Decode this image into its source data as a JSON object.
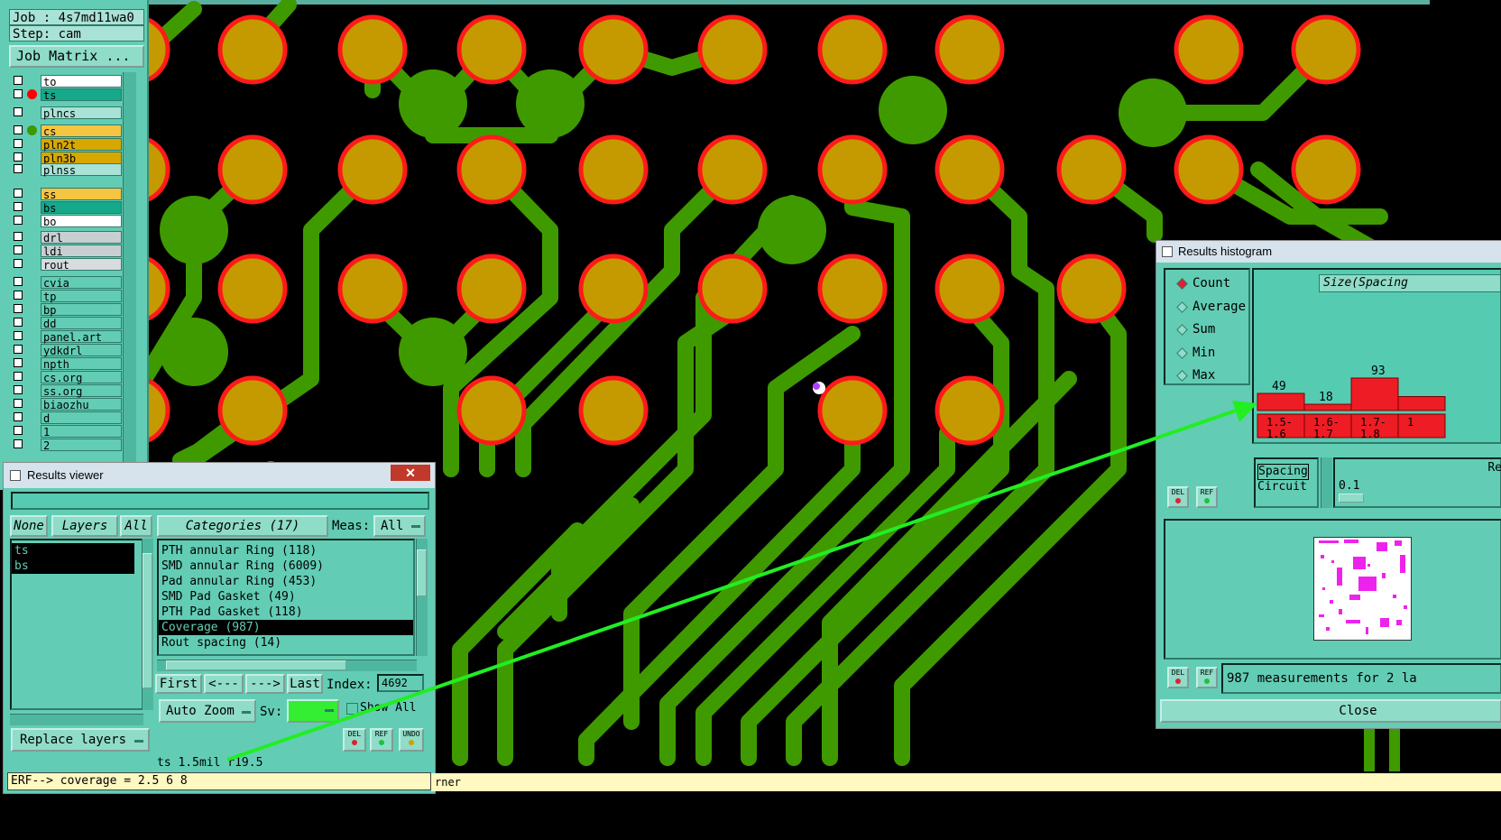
{
  "job_panel": {
    "job": "Job : 4s7md11wa0",
    "step": "Step: cam",
    "job_matrix": "Job Matrix ...",
    "layers": [
      {
        "name": "to",
        "bg": "#ffffff",
        "dot": ""
      },
      {
        "name": "ts",
        "bg": "#15a88a",
        "dot": "#ff0000"
      },
      {
        "name": "plncs",
        "bg": "#a9e2d6",
        "dot": ""
      },
      {
        "name": "cs",
        "bg": "#f5c542",
        "dot": "#3a9a00"
      },
      {
        "name": "pln2t",
        "bg": "#d8a800",
        "dot": ""
      },
      {
        "name": "pln3b",
        "bg": "#d8a800",
        "dot": ""
      },
      {
        "name": "plnss",
        "bg": "#a9e2d6",
        "dot": ""
      },
      {
        "name": "ss",
        "bg": "#f5c542",
        "dot": ""
      },
      {
        "name": "bs",
        "bg": "#15a88a",
        "dot": ""
      },
      {
        "name": "bo",
        "bg": "#ffffff",
        "dot": ""
      },
      {
        "name": "drl",
        "bg": "#c8cfd3",
        "dot": ""
      },
      {
        "name": "ldi",
        "bg": "#c8cfd3",
        "dot": ""
      },
      {
        "name": "rout",
        "bg": "#d8dcdf",
        "dot": ""
      },
      {
        "name": "cvia",
        "bg": "#62cdb4",
        "dot": ""
      },
      {
        "name": "tp",
        "bg": "#62cdb4",
        "dot": ""
      },
      {
        "name": "bp",
        "bg": "#62cdb4",
        "dot": ""
      },
      {
        "name": "dd",
        "bg": "#62cdb4",
        "dot": ""
      },
      {
        "name": "panel.art",
        "bg": "#62cdb4",
        "dot": ""
      },
      {
        "name": "ydkdrl",
        "bg": "#62cdb4",
        "dot": ""
      },
      {
        "name": "npth",
        "bg": "#62cdb4",
        "dot": ""
      },
      {
        "name": "cs.org",
        "bg": "#62cdb4",
        "dot": ""
      },
      {
        "name": "ss.org",
        "bg": "#62cdb4",
        "dot": ""
      },
      {
        "name": "biaozhu",
        "bg": "#62cdb4",
        "dot": ""
      },
      {
        "name": "d",
        "bg": "#62cdb4",
        "dot": ""
      },
      {
        "name": "1",
        "bg": "#62cdb4",
        "dot": ""
      },
      {
        "name": "2",
        "bg": "#62cdb4",
        "dot": ""
      }
    ]
  },
  "results_viewer": {
    "title": "Results viewer",
    "close": "✕",
    "none_btn": "None",
    "layers_btn": "Layers",
    "all_btn": "All",
    "layer_list": [
      "ts",
      "bs"
    ],
    "categories_btn": "Categories (17)",
    "meas_label": "Meas:",
    "meas_value": "All",
    "categories": [
      "PTH annular Ring (118)",
      "SMD annular Ring (6009)",
      "Pad annular Ring (453)",
      "SMD Pad Gasket (49)",
      "PTH Pad Gasket (118)",
      "Coverage (987)",
      "Rout spacing (14)"
    ],
    "selected_category": 5,
    "first": "First",
    "prev": "<---",
    "next": "--->",
    "last": "Last",
    "index_label": "Index:",
    "index_value": "4692",
    "auto_zoom": "Auto Zoom",
    "sv_label": "Sv:",
    "sv_color": "#33ee33",
    "show_all": "Show All",
    "replace_layers": "Replace layers",
    "del": "DEL",
    "ref": "REF",
    "undo": "UNDO"
  },
  "status_bar": "ts 1.5mil  r19.5",
  "erf_line": "ERF--> coverage = 2.5 6 8",
  "erf_tail": "rner",
  "histogram": {
    "title": "Results histogram",
    "modes": [
      "Count",
      "Average",
      "Sum",
      "Min",
      "Max"
    ],
    "selected_mode": "Count",
    "size_label": "Size(Spacing",
    "bars": [
      {
        "label": "1.5-\n1.6",
        "value": 49
      },
      {
        "label": "1.6-\n1.7",
        "value": 18
      },
      {
        "label": "1.7-\n1.8",
        "value": 93
      },
      {
        "label": "1",
        "value": 40
      }
    ],
    "bar_values_shown": [
      "49",
      "18",
      "93"
    ],
    "bin_labels": [
      "1.5-",
      "1.6",
      "1.6-",
      "1.7",
      "1.7-",
      "1.8",
      "1"
    ],
    "type_list": [
      "Spacing",
      "Circuit"
    ],
    "re_label": "Re",
    "re_value": "0.1",
    "measurements": "987 measurements for 2 la",
    "close": "Close",
    "del": "DEL",
    "ref": "REF"
  },
  "colors": {
    "panel": "#62cdb4",
    "trace": "#3f9a00",
    "pad_ring": "#ff1a1a",
    "pad_fill": "#c49a00",
    "arrow": "#22ee22"
  }
}
